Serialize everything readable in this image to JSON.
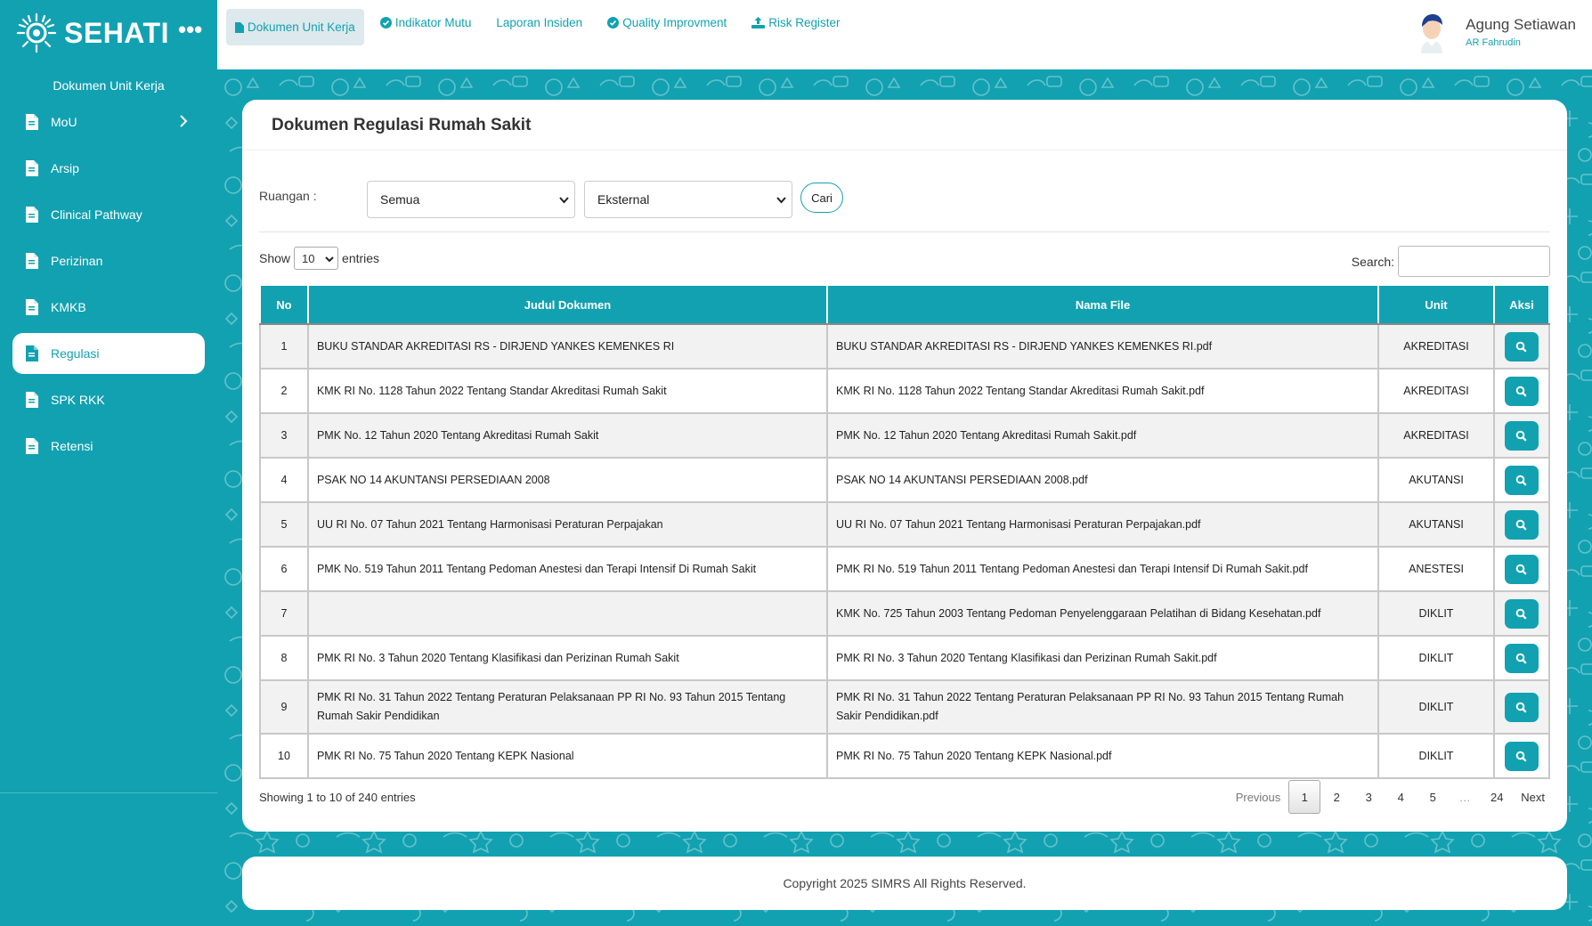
{
  "colors": {
    "primary": "#12a1b1",
    "active_tab_bg": "#dde9ec",
    "row_alt": "#f2f2f2"
  },
  "brand": {
    "name": "SEHATI",
    "logo_icon": "muhammadiyah-sun-logo",
    "menu_icon": "more-dots-icon"
  },
  "sidebar": {
    "heading": "Dokumen Unit Kerja",
    "items": [
      {
        "label": "MoU",
        "icon": "document-icon",
        "has_submenu": true
      },
      {
        "label": "Arsip",
        "icon": "document-icon"
      },
      {
        "label": "Clinical Pathway",
        "icon": "document-icon"
      },
      {
        "label": "Perizinan",
        "icon": "document-icon"
      },
      {
        "label": "KMKB",
        "icon": "document-icon"
      },
      {
        "label": "Regulasi",
        "icon": "document-icon",
        "active": true
      },
      {
        "label": "SPK RKK",
        "icon": "document-icon"
      },
      {
        "label": "Retensi",
        "icon": "document-icon"
      }
    ]
  },
  "topnav": {
    "tabs": [
      {
        "label": "Dokumen Unit Kerja",
        "icon": "file-icon",
        "active": true
      },
      {
        "label": "Indikator Mutu",
        "icon": "check-circle-icon"
      },
      {
        "label": "Laporan Insiden",
        "icon": ""
      },
      {
        "label": "Quality Improvment",
        "icon": "check-circle-icon"
      },
      {
        "label": "Risk Register",
        "icon": "upload-icon"
      }
    ]
  },
  "user": {
    "name": "Agung Setiawan",
    "subtitle": "AR Fahrudin",
    "avatar_icon": "user-avatar-icon"
  },
  "page": {
    "title": "Dokumen Regulasi Rumah Sakit",
    "filter": {
      "label": "Ruangan :",
      "ruangan_value": "Semua",
      "tipe_value": "Eksternal",
      "button": "Cari"
    },
    "length": {
      "show": "Show",
      "value": "10",
      "entries": "entries"
    },
    "search": {
      "label": "Search:",
      "value": ""
    },
    "table": {
      "headers": [
        "No",
        "Judul Dokumen",
        "Nama File",
        "Unit",
        "Aksi"
      ],
      "rows": [
        {
          "no": "1",
          "judul": "BUKU STANDAR AKREDITASI RS - DIRJEND YANKES KEMENKES RI",
          "file": "BUKU STANDAR AKREDITASI RS - DIRJEND YANKES KEMENKES RI.pdf",
          "unit": "AKREDITASI"
        },
        {
          "no": "2",
          "judul": "KMK RI No. 1128 Tahun 2022 Tentang Standar Akreditasi Rumah Sakit",
          "file": "KMK RI No. 1128 Tahun 2022 Tentang Standar Akreditasi Rumah Sakit.pdf",
          "unit": "AKREDITASI"
        },
        {
          "no": "3",
          "judul": "PMK No. 12 Tahun 2020 Tentang Akreditasi Rumah Sakit",
          "file": "PMK No. 12 Tahun 2020 Tentang Akreditasi Rumah Sakit.pdf",
          "unit": "AKREDITASI"
        },
        {
          "no": "4",
          "judul": "PSAK NO 14 AKUNTANSI PERSEDIAAN 2008",
          "file": "PSAK NO 14 AKUNTANSI PERSEDIAAN 2008.pdf",
          "unit": "AKUTANSI"
        },
        {
          "no": "5",
          "judul": "UU RI No. 07 Tahun 2021 Tentang Harmonisasi Peraturan Perpajakan",
          "file": "UU RI No. 07 Tahun 2021 Tentang Harmonisasi Peraturan Perpajakan.pdf",
          "unit": "AKUTANSI"
        },
        {
          "no": "6",
          "judul": "PMK No. 519 Tahun 2011 Tentang Pedoman Anestesi dan Terapi Intensif Di Rumah Sakit",
          "file": "PMK RI No. 519 Tahun 2011 Tentang Pedoman Anestesi dan Terapi Intensif Di Rumah Sakit.pdf",
          "unit": "ANESTESI"
        },
        {
          "no": "7",
          "judul": "",
          "file": "KMK No. 725 Tahun 2003 Tentang Pedoman Penyelenggaraan Pelatihan di Bidang Kesehatan.pdf",
          "unit": "DIKLIT"
        },
        {
          "no": "8",
          "judul": "PMK RI No. 3 Tahun 2020 Tentang Klasifikasi dan Perizinan Rumah Sakit",
          "file": "PMK RI No. 3 Tahun 2020 Tentang Klasifikasi dan Perizinan Rumah Sakit.pdf",
          "unit": "DIKLIT"
        },
        {
          "no": "9",
          "judul": "PMK RI No. 31 Tahun 2022 Tentang Peraturan Pelaksanaan PP RI No. 93 Tahun 2015 Tentang Rumah Sakir Pendidikan",
          "file": "PMK RI No. 31 Tahun 2022 Tentang Peraturan Pelaksanaan PP RI No. 93 Tahun 2015 Tentang Rumah Sakir Pendidikan.pdf",
          "unit": "DIKLIT"
        },
        {
          "no": "10",
          "judul": "PMK RI No. 75 Tahun 2020 Tentang KEPK Nasional",
          "file": "PMK RI No. 75 Tahun 2020 Tentang KEPK Nasional.pdf",
          "unit": "DIKLIT"
        }
      ],
      "action_icon": "search-icon"
    },
    "info": "Showing 1 to 10 of 240 entries",
    "pagination": {
      "previous": "Previous",
      "pages": [
        "1",
        "2",
        "3",
        "4",
        "5"
      ],
      "ellipsis": "…",
      "last": "24",
      "next": "Next",
      "current": "1"
    }
  },
  "footer": {
    "text": "Copyright 2025 SIMRS All Rights Reserved."
  }
}
